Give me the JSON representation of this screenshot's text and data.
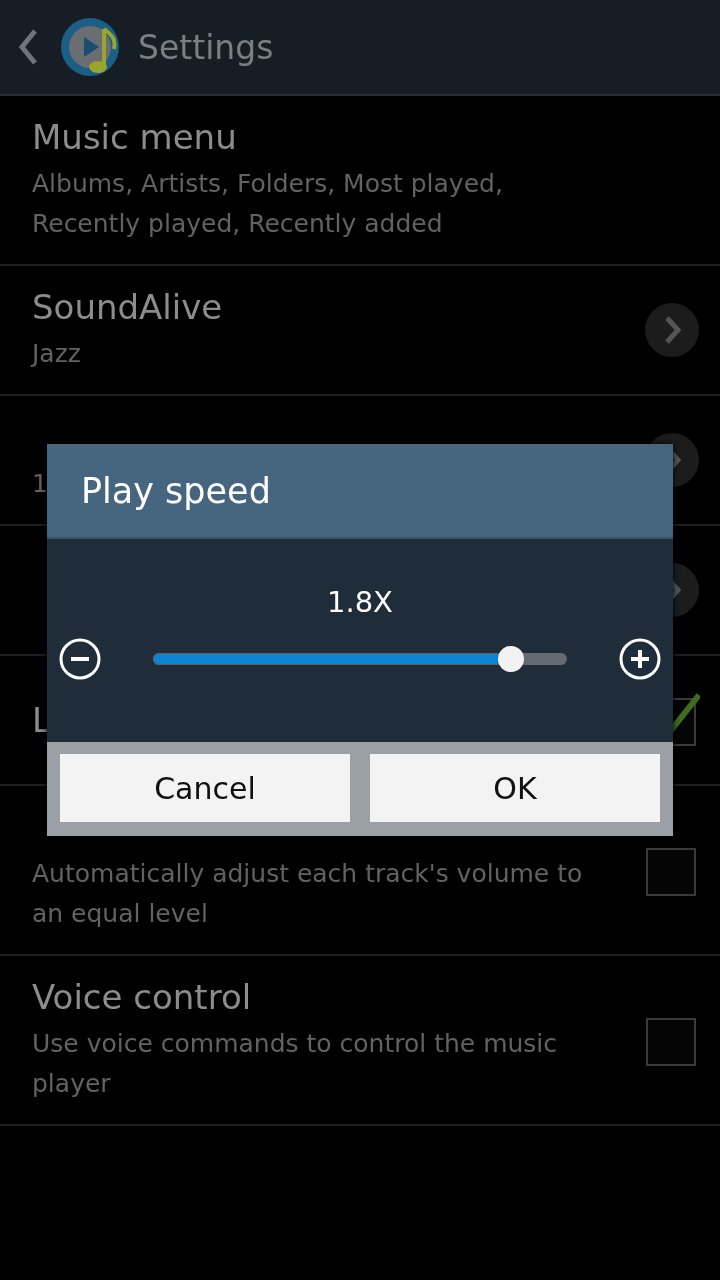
{
  "action_bar": {
    "title": "Settings"
  },
  "settings": [
    {
      "kind": "plain",
      "title": "Music menu",
      "summary": "Albums, Artists, Folders, Most played, Recently played, Recently added"
    },
    {
      "kind": "arrow",
      "title": "SoundAlive",
      "summary": "Jazz"
    },
    {
      "kind": "arrow",
      "summary": "1"
    },
    {
      "kind": "arrow"
    },
    {
      "kind": "check",
      "title": "L",
      "checked": true
    },
    {
      "kind": "check",
      "summary": "Automatically adjust each track's volume to an equal level",
      "checked": false
    },
    {
      "kind": "check",
      "title": "Voice control",
      "summary": "Use voice commands to control the music player",
      "checked": false
    }
  ],
  "dialog": {
    "title": "Play speed",
    "reading": "1.8X",
    "level": 0.865,
    "buttons": [
      "Cancel",
      "OK"
    ]
  }
}
